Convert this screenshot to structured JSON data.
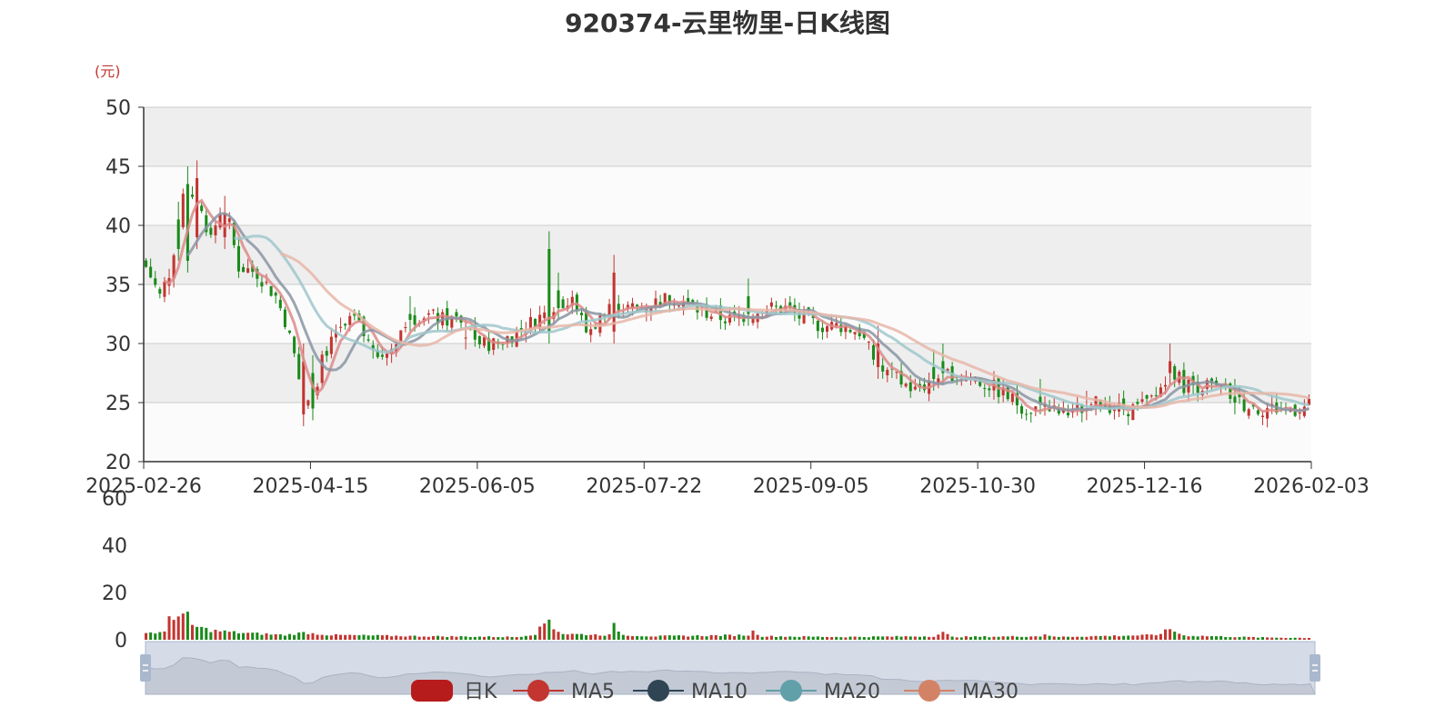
{
  "title": "920374-云里物里-日K线图",
  "colors": {
    "up": "#c23531",
    "down": "#1a8a1a",
    "ma5": "#dd8a89",
    "ma10": "#8a95a3",
    "ma20": "#9fc7cb",
    "ma30": "#e7b6a8",
    "grid": "#cccccc",
    "band_dark": "#eeeeee",
    "band_light": "#fbfbfb",
    "slider_bg": "#d5dce8",
    "slider_border": "#a9b8cc"
  },
  "legend": [
    {
      "name": "日K",
      "icon": "candle-icon",
      "color": "#b71c1c"
    },
    {
      "name": "MA5",
      "icon": "ma5-icon",
      "color": "#c23531"
    },
    {
      "name": "MA10",
      "icon": "ma10-icon",
      "color": "#2f4554"
    },
    {
      "name": "MA20",
      "icon": "ma20-icon",
      "color": "#61a0a8"
    },
    {
      "name": "MA30",
      "icon": "ma30-icon",
      "color": "#d48265"
    }
  ],
  "chart_data": {
    "type": "candlestick",
    "y_unit": "(元)",
    "price_axis": {
      "min": 20,
      "max": 50,
      "ticks": [
        20,
        25,
        30,
        35,
        40,
        45,
        50
      ]
    },
    "volume_axis": {
      "min": 0,
      "max": 60,
      "ticks": [
        0,
        20,
        40,
        60
      ]
    },
    "x_start": "2025-02-26",
    "x_end": "2026-02-03",
    "x_tick_labels": [
      "2025-02-26",
      "2025-04-15",
      "2025-06-05",
      "2025-07-22",
      "2025-09-05",
      "2025-10-30",
      "2025-12-16",
      "2026-02-03"
    ],
    "close_anchors": [
      [
        0,
        36.5
      ],
      [
        3,
        34
      ],
      [
        5,
        36
      ],
      [
        8,
        42
      ],
      [
        10,
        43
      ],
      [
        12,
        41
      ],
      [
        14,
        39
      ],
      [
        16,
        41
      ],
      [
        18,
        40
      ],
      [
        20,
        36.5
      ],
      [
        24,
        36
      ],
      [
        28,
        34
      ],
      [
        30,
        32
      ],
      [
        32,
        29
      ],
      [
        34,
        25
      ],
      [
        36,
        25
      ],
      [
        38,
        29
      ],
      [
        42,
        31
      ],
      [
        45,
        32
      ],
      [
        48,
        30
      ],
      [
        52,
        29
      ],
      [
        56,
        32
      ],
      [
        60,
        32.5
      ],
      [
        64,
        32
      ],
      [
        68,
        32
      ],
      [
        72,
        30
      ],
      [
        76,
        30
      ],
      [
        80,
        31
      ],
      [
        84,
        32
      ],
      [
        88,
        33
      ],
      [
        92,
        34
      ],
      [
        95,
        31
      ],
      [
        98,
        32
      ],
      [
        100,
        34
      ],
      [
        103,
        33
      ],
      [
        106,
        33
      ],
      [
        110,
        33.5
      ],
      [
        114,
        34
      ],
      [
        118,
        33
      ],
      [
        122,
        32.5
      ],
      [
        126,
        32
      ],
      [
        130,
        32.5
      ],
      [
        134,
        33
      ],
      [
        138,
        33
      ],
      [
        142,
        32
      ],
      [
        146,
        31.5
      ],
      [
        150,
        31.5
      ],
      [
        154,
        31
      ],
      [
        158,
        28
      ],
      [
        162,
        27
      ],
      [
        166,
        26
      ],
      [
        170,
        27
      ],
      [
        174,
        27.5
      ],
      [
        178,
        27
      ],
      [
        182,
        26.5
      ],
      [
        186,
        25.5
      ],
      [
        190,
        24.5
      ],
      [
        194,
        24.5
      ],
      [
        198,
        24
      ],
      [
        202,
        24.5
      ],
      [
        206,
        25
      ],
      [
        210,
        24.5
      ],
      [
        214,
        24.5
      ],
      [
        218,
        25.5
      ],
      [
        221,
        28
      ],
      [
        224,
        26.5
      ],
      [
        228,
        26.5
      ],
      [
        232,
        26
      ],
      [
        236,
        25
      ],
      [
        240,
        24.5
      ],
      [
        244,
        24.5
      ],
      [
        248,
        24.5
      ],
      [
        251,
        24.7
      ]
    ],
    "spikes": [
      [
        7,
        37,
        42
      ],
      [
        9,
        36,
        45
      ],
      [
        11,
        38,
        45.5
      ],
      [
        17,
        38,
        42.5
      ],
      [
        34,
        23,
        30
      ],
      [
        36,
        23.5,
        29
      ],
      [
        57,
        31,
        34
      ],
      [
        69,
        29.5,
        32
      ],
      [
        87,
        30,
        39.5
      ],
      [
        89,
        32,
        36
      ],
      [
        101,
        30,
        37.5
      ],
      [
        130,
        31.5,
        35.5
      ],
      [
        158,
        27,
        31.5
      ],
      [
        170,
        26,
        29.5
      ],
      [
        172,
        26.5,
        30
      ],
      [
        193,
        24,
        27
      ],
      [
        203,
        23.5,
        26
      ],
      [
        221,
        26.5,
        30
      ],
      [
        235,
        24,
        27
      ]
    ],
    "volume_anchors": [
      [
        0,
        3
      ],
      [
        4,
        3
      ],
      [
        5,
        10
      ],
      [
        9,
        10
      ],
      [
        10,
        6
      ],
      [
        14,
        4
      ],
      [
        20,
        3
      ],
      [
        30,
        2
      ],
      [
        34,
        3
      ],
      [
        40,
        2
      ],
      [
        60,
        1.5
      ],
      [
        80,
        1.2
      ],
      [
        84,
        2.5
      ],
      [
        87,
        9
      ],
      [
        88,
        5
      ],
      [
        90,
        2.5
      ],
      [
        100,
        2
      ],
      [
        101,
        6
      ],
      [
        103,
        2
      ],
      [
        110,
        1.5
      ],
      [
        130,
        2
      ],
      [
        131,
        3.5
      ],
      [
        133,
        1.5
      ],
      [
        150,
        1.2
      ],
      [
        170,
        1.5
      ],
      [
        172,
        3
      ],
      [
        174,
        1.2
      ],
      [
        193,
        1.5
      ],
      [
        194,
        2.5
      ],
      [
        196,
        1.2
      ],
      [
        218,
        2
      ],
      [
        221,
        4.5
      ],
      [
        224,
        1.8
      ],
      [
        240,
        1
      ],
      [
        251,
        0.8
      ]
    ]
  }
}
